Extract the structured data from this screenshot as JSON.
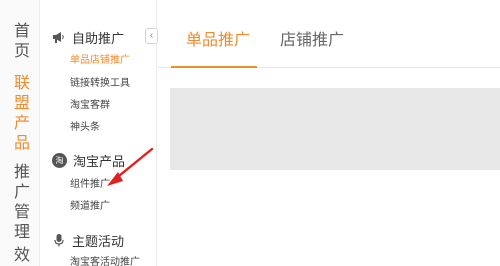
{
  "leftnav": {
    "groups": [
      {
        "label": "首页"
      },
      {
        "label": "联盟产品"
      },
      {
        "label": "推广管理"
      },
      {
        "label": "效"
      }
    ]
  },
  "sidebar": {
    "collapse_glyph": "‹",
    "sections": [
      {
        "title": "自助推广",
        "icon": "megaphone-icon",
        "items": [
          "单品店铺推广",
          "链接转换工具",
          "淘宝客群",
          "神头条"
        ]
      },
      {
        "title": "淘宝产品",
        "icon": "taobao-icon",
        "icon_glyph": "淘",
        "items": [
          "组件推广",
          "频道推广"
        ]
      },
      {
        "title": "主题活动",
        "icon": "microphone-icon",
        "items": [
          "淘宝客活动推广"
        ]
      }
    ]
  },
  "main": {
    "tabs": [
      {
        "label": "单品推广"
      },
      {
        "label": "店铺推广"
      }
    ]
  },
  "colors": {
    "accent": "#f08c2f",
    "annotation_arrow": "#e02020"
  }
}
